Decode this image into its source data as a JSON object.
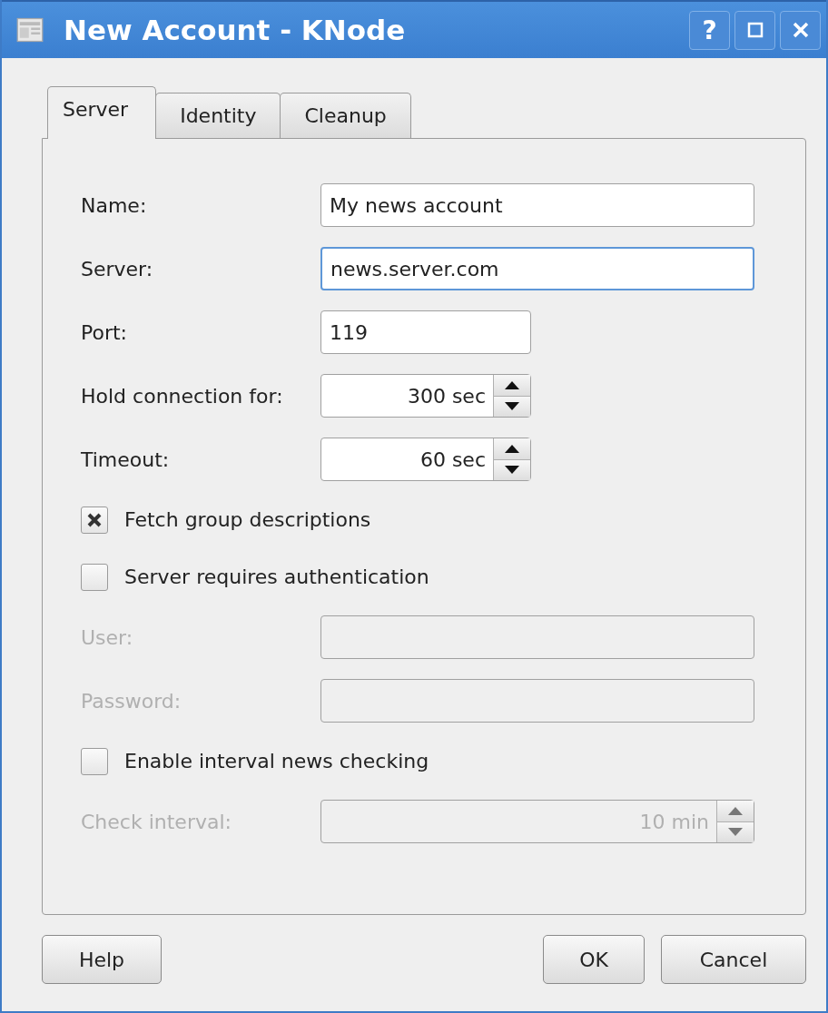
{
  "window": {
    "title": "New Account - KNode",
    "controls": [
      {
        "kind": "help",
        "label": "?"
      },
      {
        "kind": "maximize"
      },
      {
        "kind": "close"
      }
    ]
  },
  "tabs": [
    {
      "label": "Server",
      "selected": true
    },
    {
      "label": "Identity",
      "selected": false
    },
    {
      "label": "Cleanup",
      "selected": false
    }
  ],
  "form": [
    {
      "kind": "text",
      "label": "Name:",
      "value": "My news account",
      "disabled": false,
      "focused": false
    },
    {
      "kind": "text",
      "label": "Server:",
      "value": "news.server.com",
      "disabled": false,
      "focused": true
    },
    {
      "kind": "number",
      "label": "Port:",
      "value": "119",
      "disabled": false,
      "focused": false
    },
    {
      "kind": "spin",
      "label": "Hold connection for:",
      "value": "300 sec",
      "disabled": false
    },
    {
      "kind": "spin",
      "label": "Timeout:",
      "value": "60 sec",
      "disabled": false
    },
    {
      "kind": "checkbox",
      "label": "Fetch group descriptions",
      "checked": true
    },
    {
      "kind": "checkbox",
      "label": "Server requires authentication",
      "checked": false
    },
    {
      "kind": "text",
      "label": "User:",
      "disabled": true,
      "focused": false
    },
    {
      "kind": "text",
      "label": "Password:",
      "disabled": true,
      "focused": false
    },
    {
      "kind": "checkbox",
      "label": "Enable interval news checking",
      "checked": false
    },
    {
      "kind": "spin",
      "label": "Check interval:",
      "value": "10 min",
      "disabled": true
    }
  ],
  "buttons": [
    {
      "kind": "help",
      "label": "Help"
    },
    {
      "kind": "ok",
      "label": "OK"
    },
    {
      "kind": "cancel",
      "label": "Cancel"
    }
  ]
}
